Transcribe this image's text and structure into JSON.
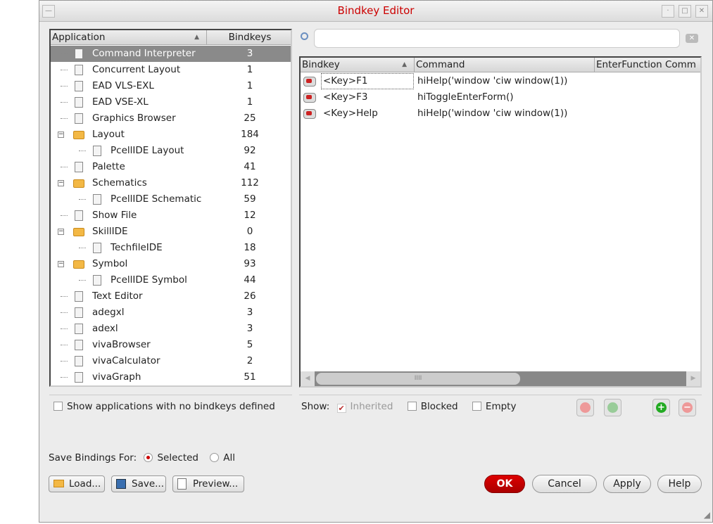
{
  "window": {
    "title": "Bindkey Editor"
  },
  "apps": {
    "headers": [
      "Application",
      "Bindkeys"
    ],
    "rows": [
      {
        "name": "Command Interpreter",
        "count": "3",
        "level": 0,
        "type": "doc"
      },
      {
        "name": "Concurrent Layout",
        "count": "1",
        "level": 0,
        "type": "doc"
      },
      {
        "name": "EAD VLS-EXL",
        "count": "1",
        "level": 0,
        "type": "doc"
      },
      {
        "name": "EAD VSE-XL",
        "count": "1",
        "level": 0,
        "type": "doc"
      },
      {
        "name": "Graphics Browser",
        "count": "25",
        "level": 0,
        "type": "doc"
      },
      {
        "name": "Layout",
        "count": "184",
        "level": 0,
        "type": "folder"
      },
      {
        "name": "PcellIDE Layout",
        "count": "92",
        "level": 1,
        "type": "doc"
      },
      {
        "name": "Palette",
        "count": "41",
        "level": 0,
        "type": "doc"
      },
      {
        "name": "Schematics",
        "count": "112",
        "level": 0,
        "type": "folder"
      },
      {
        "name": "PcellIDE Schematic",
        "count": "59",
        "level": 1,
        "type": "doc"
      },
      {
        "name": "Show File",
        "count": "12",
        "level": 0,
        "type": "doc"
      },
      {
        "name": "SkillIDE",
        "count": "0",
        "level": 0,
        "type": "folder"
      },
      {
        "name": "TechfileIDE",
        "count": "18",
        "level": 1,
        "type": "doc"
      },
      {
        "name": "Symbol",
        "count": "93",
        "level": 0,
        "type": "folder"
      },
      {
        "name": "PcellIDE Symbol",
        "count": "44",
        "level": 1,
        "type": "doc"
      },
      {
        "name": "Text Editor",
        "count": "26",
        "level": 0,
        "type": "doc"
      },
      {
        "name": "adegxl",
        "count": "3",
        "level": 0,
        "type": "doc"
      },
      {
        "name": "adexl",
        "count": "3",
        "level": 0,
        "type": "doc"
      },
      {
        "name": "vivaBrowser",
        "count": "5",
        "level": 0,
        "type": "doc"
      },
      {
        "name": "vivaCalculator",
        "count": "2",
        "level": 0,
        "type": "doc"
      },
      {
        "name": "vivaGraph",
        "count": "51",
        "level": 0,
        "type": "doc"
      }
    ]
  },
  "show_no_bindkeys": "Show applications with no bindkeys defined",
  "search": {
    "value": ""
  },
  "bindings": {
    "headers": [
      "Bindkey",
      "Command",
      "EnterFunction Comm"
    ],
    "rows": [
      {
        "key": "<Key>F1",
        "command": "hiHelp('window 'ciw window(1))"
      },
      {
        "key": "<Key>F3",
        "command": "hiToggleEnterForm()"
      },
      {
        "key": "<Key>Help",
        "command": "hiHelp('window 'ciw window(1))"
      }
    ]
  },
  "show": {
    "label": "Show:",
    "inherited": "Inherited",
    "blocked": "Blocked",
    "empty": "Empty"
  },
  "save_for": {
    "label": "Save Bindings For:",
    "selected": "Selected",
    "all": "All"
  },
  "buttons": {
    "load": "Load...",
    "save": "Save...",
    "preview": "Preview...",
    "ok": "OK",
    "cancel": "Cancel",
    "apply": "Apply",
    "help": "Help"
  }
}
